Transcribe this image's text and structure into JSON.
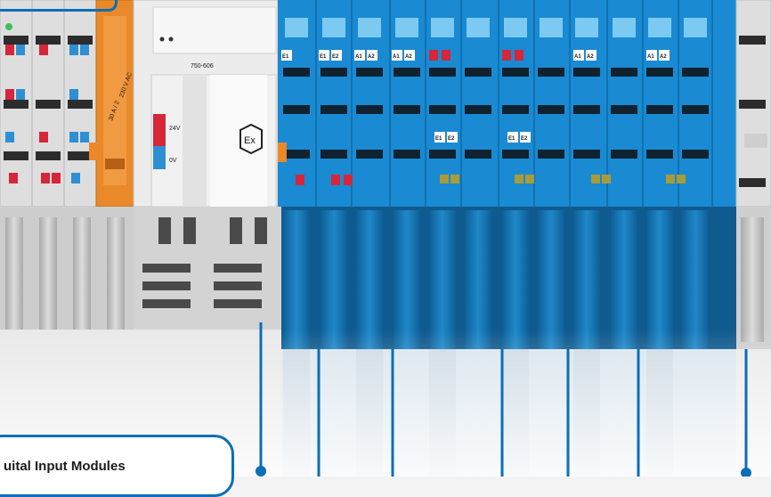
{
  "photo": {
    "module_model": "750-606",
    "supply_labels": [
      "24V",
      "0V"
    ],
    "atex_mark": "Ex",
    "power_module_text": [
      "30 A / 2",
      "230 V AC"
    ],
    "module_tags": [
      "E1",
      "E1",
      "E2",
      "A1",
      "A2",
      "A1",
      "A2",
      "E1",
      "E2",
      "E1",
      "E2",
      "A1",
      "A2",
      "A1",
      "A2"
    ],
    "colors": {
      "blue_module": "#1a8ad2",
      "orange_module": "#e9892a",
      "callout_blue": "#0a6fb8",
      "grey_module": "#c9c9c9"
    }
  },
  "callout": {
    "title": "uital Input Modules"
  }
}
